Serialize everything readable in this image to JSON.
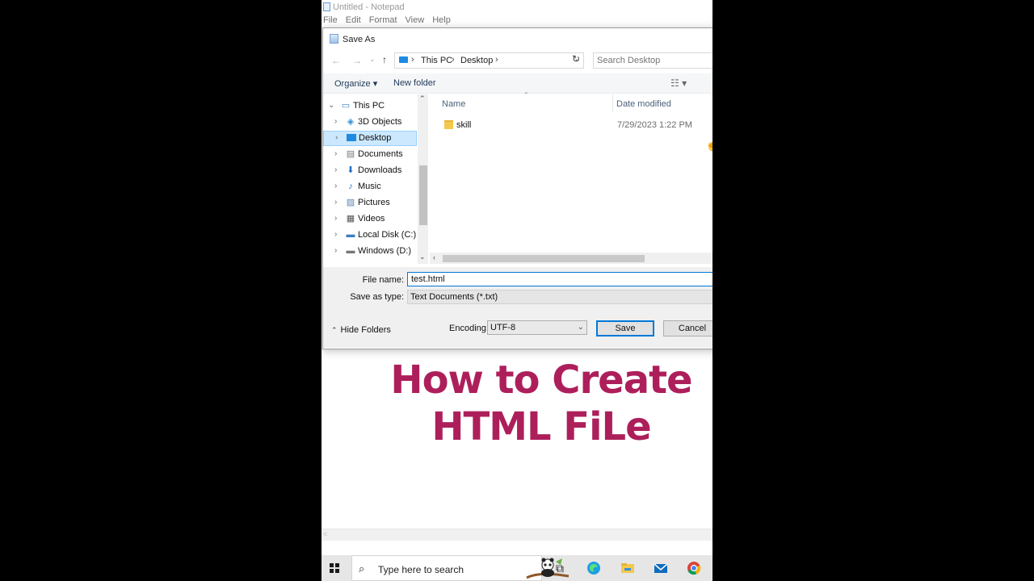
{
  "notepad": {
    "title": "Untitled - Notepad",
    "menu": [
      "File",
      "Edit",
      "Format",
      "View",
      "Help"
    ],
    "scroll_left": "<"
  },
  "dialog": {
    "title": "Save As",
    "address": {
      "crumbs": [
        "This PC",
        "Desktop"
      ]
    },
    "search_placeholder": "Search Desktop",
    "toolbar": {
      "organize": "Organize ▾",
      "new_folder": "New folder"
    },
    "tree": [
      {
        "label": "This PC",
        "icon": "this-pc-icon",
        "root": true
      },
      {
        "label": "3D Objects",
        "icon": "3d-objects-icon"
      },
      {
        "label": "Desktop",
        "icon": "desktop-icon",
        "selected": true
      },
      {
        "label": "Documents",
        "icon": "documents-icon"
      },
      {
        "label": "Downloads",
        "icon": "downloads-icon"
      },
      {
        "label": "Music",
        "icon": "music-icon"
      },
      {
        "label": "Pictures",
        "icon": "pictures-icon"
      },
      {
        "label": "Videos",
        "icon": "videos-icon"
      },
      {
        "label": "Local Disk (C:)",
        "icon": "local-disk-icon"
      },
      {
        "label": "Windows (D:)",
        "icon": "drive-icon"
      }
    ],
    "columns": {
      "name": "Name",
      "date_modified": "Date modified"
    },
    "files": [
      {
        "name": "skill",
        "date": "7/29/2023 1:22 PM",
        "icon": "folder-icon"
      }
    ],
    "file_name_label": "File name:",
    "file_name_value": "test.html",
    "save_as_type_label": "Save as type:",
    "save_as_type_value": "Text Documents (*.txt)",
    "hide_folders": "Hide Folders",
    "encoding_label": "Encoding:",
    "encoding_value": "UTF-8",
    "save": "Save",
    "cancel": "Cancel"
  },
  "overlay": {
    "line1": "How to Create",
    "line2": "HTML FiLe"
  },
  "taskbar": {
    "search_text": "Type here to search"
  },
  "colors": {
    "accent": "#0078d7",
    "heading": "#ad1f5b",
    "selection": "#cce8ff"
  }
}
